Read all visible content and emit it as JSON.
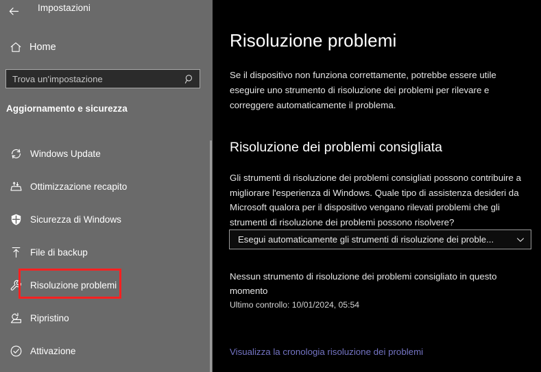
{
  "window": {
    "app_title": "Impostazioni",
    "back_icon": "back-arrow-icon"
  },
  "sidebar": {
    "home": {
      "label": "Home",
      "icon": "home-icon"
    },
    "search": {
      "placeholder": "Trova un'impostazione",
      "value": "",
      "icon": "search-icon"
    },
    "group_header": "Aggiornamento e sicurezza",
    "items": [
      {
        "label": "Windows Update",
        "icon": "sync-refresh-icon"
      },
      {
        "label": "Ottimizzazione recapito",
        "icon": "delivery-optimization-icon"
      },
      {
        "label": "Sicurezza di Windows",
        "icon": "shield-icon"
      },
      {
        "label": "File di backup",
        "icon": "upload-arrow-icon"
      },
      {
        "label": "Risoluzione problemi",
        "icon": "wrench-icon"
      },
      {
        "label": "Ripristino",
        "icon": "recovery-icon"
      },
      {
        "label": "Attivazione",
        "icon": "check-circle-icon"
      }
    ],
    "selected_item": "Risoluzione problemi",
    "highlight_color": "#ff2020"
  },
  "main": {
    "page_title": "Risoluzione problemi",
    "intro": "Se il dispositivo non funziona correttamente, potrebbe essere utile eseguire uno strumento di risoluzione dei problemi per rilevare e correggere automaticamente il problema.",
    "section_title": "Risoluzione dei problemi consigliata",
    "section_body": "Gli strumenti di risoluzione dei problemi consigliati possono contribuire a migliorare l'esperienza di Windows. Quale tipo di assistenza desideri da Microsoft qualora per il dispositivo vengano rilevati problemi che gli strumenti di risoluzione dei problemi possono risolvere?",
    "dropdown": {
      "selected": "Esegui automaticamente gli strumenti di risoluzione dei proble...",
      "icon": "chevron-down-icon"
    },
    "status_text": "Nessun strumento di risoluzione dei problemi consigliato in questo momento",
    "last_check": "Ultimo controllo: 10/01/2024, 05:54",
    "history_link": "Visualizza la cronologia risoluzione dei problemi",
    "link_color": "#7474c4"
  }
}
